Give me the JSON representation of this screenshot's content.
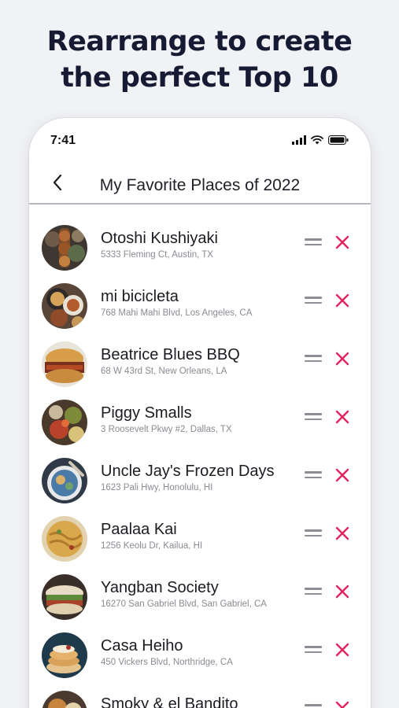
{
  "headline": {
    "line1": "Rearrange to create",
    "line2": "the perfect Top 10"
  },
  "status_bar": {
    "time": "7:41",
    "icons": [
      "signal-icon",
      "wifi-icon",
      "battery-icon"
    ]
  },
  "nav": {
    "back_icon": "chevron-left-icon",
    "title": "My Favorite Places of 2022"
  },
  "colors": {
    "background": "#f1f2f6",
    "headline": "#171a33",
    "remove_accent": "#e0245e",
    "drag_handle": "#8d8d95"
  },
  "places": [
    {
      "name": "Otoshi Kushiyaki",
      "address": "5333 Fleming Ct, Austin, TX"
    },
    {
      "name": "mi bicicleta",
      "address": "768 Mahi Mahi Blvd, Los Angeles, CA"
    },
    {
      "name": "Beatrice Blues BBQ",
      "address": "68 W 43rd St, New Orleans, LA"
    },
    {
      "name": "Piggy Smalls",
      "address": "3 Roosevelt Pkwy #2, Dallas, TX"
    },
    {
      "name": "Uncle Jay's Frozen Days",
      "address": "1623 Pali Hwy, Honolulu, HI"
    },
    {
      "name": "Paalaa Kai",
      "address": "1256 Keolu Dr, Kailua, HI"
    },
    {
      "name": "Yangban Society",
      "address": "16270 San Gabriel Blvd, San Gabriel, CA"
    },
    {
      "name": "Casa Heiho",
      "address": "450 Vickers Blvd, Northridge, CA"
    },
    {
      "name": "Smoky & el Bandito",
      "address": ""
    }
  ]
}
